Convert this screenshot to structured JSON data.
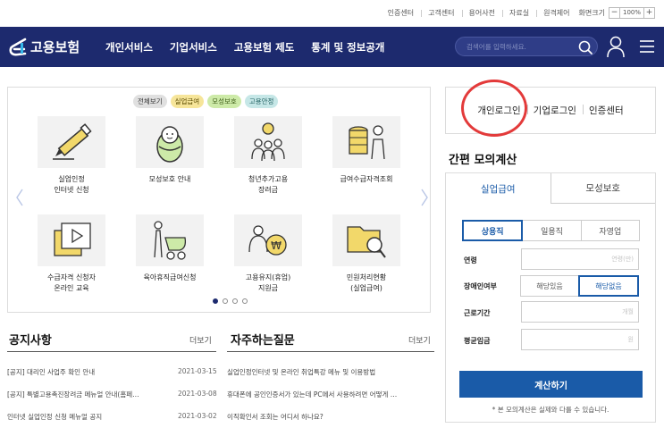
{
  "util_links": [
    "인증센터",
    "고객센터",
    "용어사전",
    "자료실",
    "원격제어"
  ],
  "zoom": {
    "label": "화면크기",
    "minus": "−",
    "value": "100%",
    "plus": "+"
  },
  "header": {
    "logo_text": "고용보험",
    "nav": [
      "개인서비스",
      "기업서비스",
      "고용보험 제도",
      "통계 및 정보공개"
    ],
    "search_placeholder": "검색어를 입력하세요."
  },
  "slider": {
    "categories": [
      "전체보기",
      "실업급여",
      "모성보호",
      "고용안정"
    ],
    "items": [
      {
        "label": "실업인정\n인터넷 신청",
        "icon": "pencil-icon"
      },
      {
        "label": "모성보호 안내",
        "icon": "baby-icon"
      },
      {
        "label": "청년추가고용\n장려금",
        "icon": "youth-idea-icon"
      },
      {
        "label": "급여수급자격조회",
        "icon": "coins-person-icon"
      },
      {
        "label": "수급자격 신청자\n온라인 교육",
        "icon": "video-play-icon"
      },
      {
        "label": "육아휴직급여신청",
        "icon": "stroller-icon"
      },
      {
        "label": "고용유지(휴업)\n지원금",
        "icon": "won-coin-people-icon"
      },
      {
        "label": "민원처리현황\n(실업급여)",
        "icon": "folder-search-icon"
      }
    ],
    "page_count": 4,
    "active_page": 1
  },
  "notices": {
    "title": "공지사항",
    "more": "더보기",
    "rows": [
      {
        "title": "[공지] 대리인 사업주 확인 안내",
        "date": "2021-03-15"
      },
      {
        "title": "[공지] 특별고용촉진장려금 메뉴얼 안내(홈페…",
        "date": "2021-03-08"
      },
      {
        "title": "인터넷 실업인정 신청 메뉴얼 공지",
        "date": "2021-03-02"
      }
    ]
  },
  "faq": {
    "title": "자주하는질문",
    "more": "더보기",
    "rows": [
      "실업인정인터넷 및 온라인 취업특강 메뉴 및 이용방법",
      "휴대폰에 공인인증서가 있는데 PC에서 사용하려면 어떻게 …",
      "이직확인서 조회는 어디서 하나요?"
    ]
  },
  "login_tabs": [
    "개인로그인",
    "기업로그인",
    "인증센터"
  ],
  "calc": {
    "title": "간편 모의계산",
    "tabs": [
      "실업급여",
      "모성보호"
    ],
    "job_types": [
      "상용직",
      "일용직",
      "자영업"
    ],
    "age_label": "연령",
    "age_placeholder": "연령(만)",
    "disability_label": "장애인여부",
    "disability_options": [
      "해당있음",
      "해당없음"
    ],
    "period_label": "근로기간",
    "period_placeholder": "개월",
    "wage_label": "평균임금",
    "wage_placeholder": "원",
    "button": "계산하기",
    "note": "* 본 모의계산은 실제와 다를 수 있습니다."
  },
  "colors": {
    "header_bg": "#1d2a6e",
    "accent_blue": "#1a5ba8",
    "highlight_circle": "#e33a3a"
  }
}
